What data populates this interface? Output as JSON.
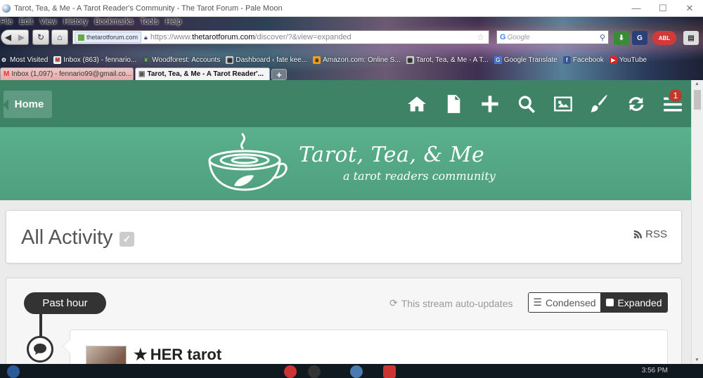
{
  "window": {
    "title": "Tarot, Tea, & Me - A Tarot Reader's Community - The Tarot Forum - Pale Moon",
    "controls": {
      "minimize": "—",
      "maximize": "☐",
      "close": "✕"
    }
  },
  "menubar": [
    "File",
    "Edit",
    "View",
    "History",
    "Bookmarks",
    "Tools",
    "Help"
  ],
  "navbar": {
    "site_identity": "thetarotforum.com",
    "url_prefix": "https://www.",
    "url_domain": "thetarotforum.com",
    "url_path": "/discover/?&view=expanded",
    "search_placeholder": "Google",
    "search_engine_letter": "G",
    "addon_badge": "ABL"
  },
  "bookmarks": [
    {
      "label": "Most Visited",
      "icon": "gear-icon"
    },
    {
      "label": "Inbox (863) - fennario...",
      "icon": "gmail-icon"
    },
    {
      "label": "Woodforest: Accounts",
      "icon": "leaf-icon"
    },
    {
      "label": "Dashboard ‹ fate kee...",
      "icon": "dashboard-icon"
    },
    {
      "label": "Amazon.com: Online S...",
      "icon": "amazon-icon"
    },
    {
      "label": "Tarot, Tea, & Me - A T...",
      "icon": "tarot-icon"
    },
    {
      "label": "Google Translate",
      "icon": "translate-icon"
    },
    {
      "label": "Facebook",
      "icon": "facebook-icon"
    },
    {
      "label": "YouTube",
      "icon": "youtube-icon"
    }
  ],
  "tabs": [
    {
      "label": "Inbox (1,097) - fennario99@gmail.co...",
      "active": false
    },
    {
      "label": "Tarot, Tea, & Me - A Tarot Reader'...",
      "active": true
    }
  ],
  "site": {
    "home_crumb": "Home",
    "notification_count": "1",
    "logo_title": "Tarot, Tea, & Me",
    "logo_subtitle": "a tarot readers community",
    "nav_icons": [
      "home-icon",
      "document-icon",
      "plus-icon",
      "search-icon",
      "image-icon",
      "brush-icon",
      "refresh-icon",
      "menu-icon"
    ]
  },
  "activity": {
    "title": "All Activity",
    "rss_label": "RSS"
  },
  "stream": {
    "time_label": "Past hour",
    "auto_update_text": "This stream auto-updates",
    "view_condensed": "Condensed",
    "view_expanded": "Expanded",
    "active_view": "Expanded"
  },
  "post": {
    "title": "HER tarot"
  },
  "taskbar": {
    "clock": "3:56 PM"
  },
  "colors": {
    "site_nav": "#3f8367",
    "banner": "#56a886",
    "notification": "#c0392b",
    "dark": "#333333"
  }
}
